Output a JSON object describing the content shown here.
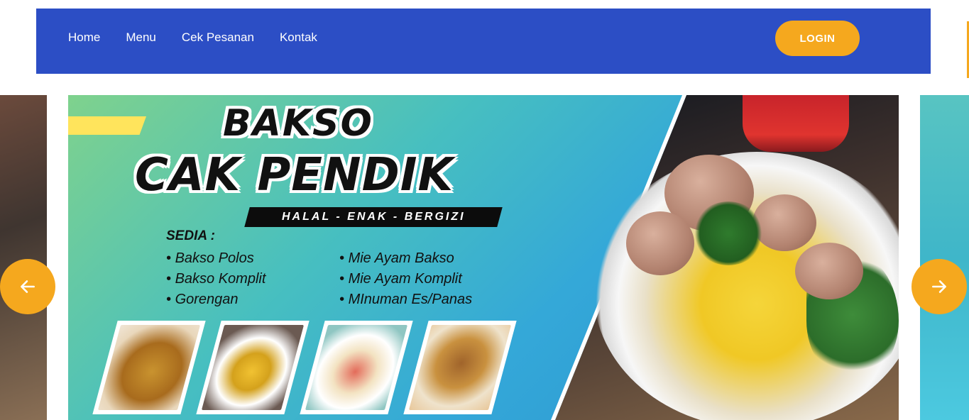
{
  "nav": {
    "links": [
      "Home",
      "Menu",
      "Cek Pesanan",
      "Kontak"
    ],
    "login_label": "LOGIN"
  },
  "banner": {
    "title_line1": "BAKSO",
    "title_line2": "CAK PENDIK",
    "tagline": "HALAL - ENAK - BERGIZI",
    "sedia_label": "SEDIA :",
    "menu_col1": [
      "Bakso Polos",
      "Bakso Komplit",
      "Gorengan"
    ],
    "menu_col2": [
      "Mie Ayam Bakso",
      "Mie Ayam Komplit",
      "MInuman Es/Panas"
    ]
  },
  "colors": {
    "navbar": "#2c4ec5",
    "accent": "#f5a81e"
  },
  "icons": {
    "prev": "arrow-left-icon",
    "next": "arrow-right-icon"
  }
}
